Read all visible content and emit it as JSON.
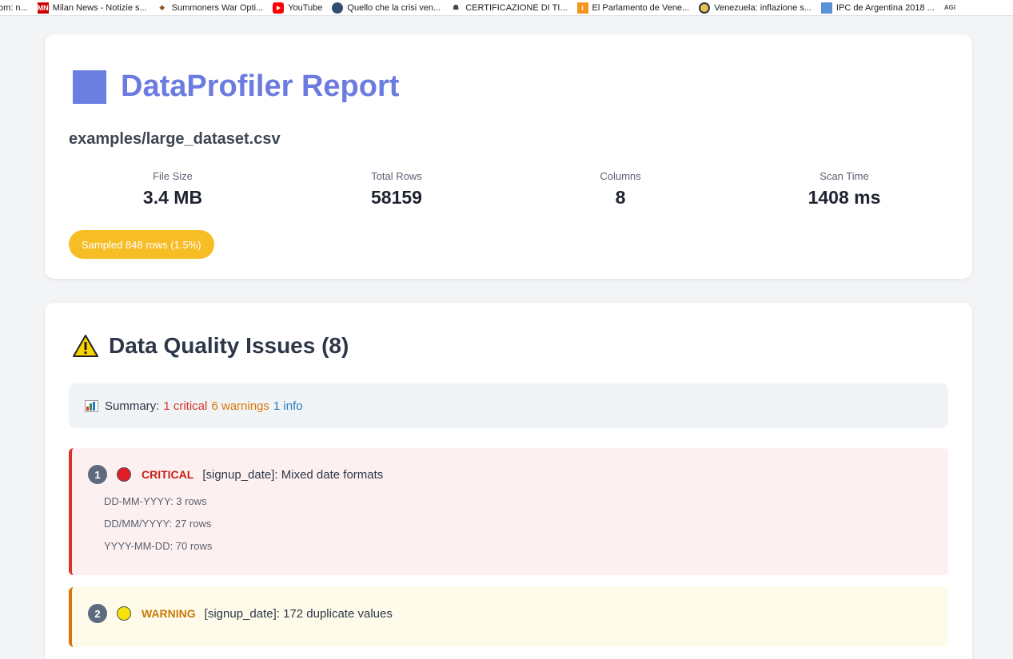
{
  "bookmarks": [
    {
      "label": "om: n...",
      "icon": "bookmark-icon"
    },
    {
      "label": "Milan News - Notizie s...",
      "icon": "milan-news-icon"
    },
    {
      "label": "Summoners War Opti...",
      "icon": "summoners-war-icon"
    },
    {
      "label": "YouTube",
      "icon": "youtube-icon"
    },
    {
      "label": "Quello che la crisi ven...",
      "icon": "globe-icon"
    },
    {
      "label": "CERTIFICAZIONE DI TI...",
      "icon": "certificate-icon"
    },
    {
      "label": "El Parlamento de Vene...",
      "icon": "info-icon"
    },
    {
      "label": "Venezuela: inflazione s...",
      "icon": "coin-icon"
    },
    {
      "label": "IPC de Argentina 2018 ...",
      "icon": "chart-icon"
    },
    {
      "label": "AGI",
      "icon": "agi-icon"
    }
  ],
  "report": {
    "title": "DataProfiler Report",
    "filename": "examples/large_dataset.csv",
    "stats": [
      {
        "label": "File Size",
        "value": "3.4 MB"
      },
      {
        "label": "Total Rows",
        "value": "58159"
      },
      {
        "label": "Columns",
        "value": "8"
      },
      {
        "label": "Scan Time",
        "value": "1408 ms"
      }
    ],
    "sample_badge": "Sampled 848 rows (1.5%)"
  },
  "issues_section": {
    "title": "Data Quality Issues (8)",
    "summary": {
      "prefix": "Summary:",
      "critical": "1 critical",
      "warnings": "6 warnings",
      "info": "1 info"
    },
    "issues": [
      {
        "number": "1",
        "severity": "CRITICAL",
        "message": "[signup_date]: Mixed date formats",
        "details": [
          "DD-MM-YYYY: 3 rows",
          "DD/MM/YYYY: 27 rows",
          "YYYY-MM-DD: 70 rows"
        ]
      },
      {
        "number": "2",
        "severity": "WARNING",
        "message": "[signup_date]: 172 duplicate values"
      }
    ]
  },
  "colors": {
    "accent": "#6b7be0",
    "critical": "#d9342b",
    "warning": "#d97706",
    "info": "#2b7bb9",
    "badge": "#f6bd25"
  }
}
